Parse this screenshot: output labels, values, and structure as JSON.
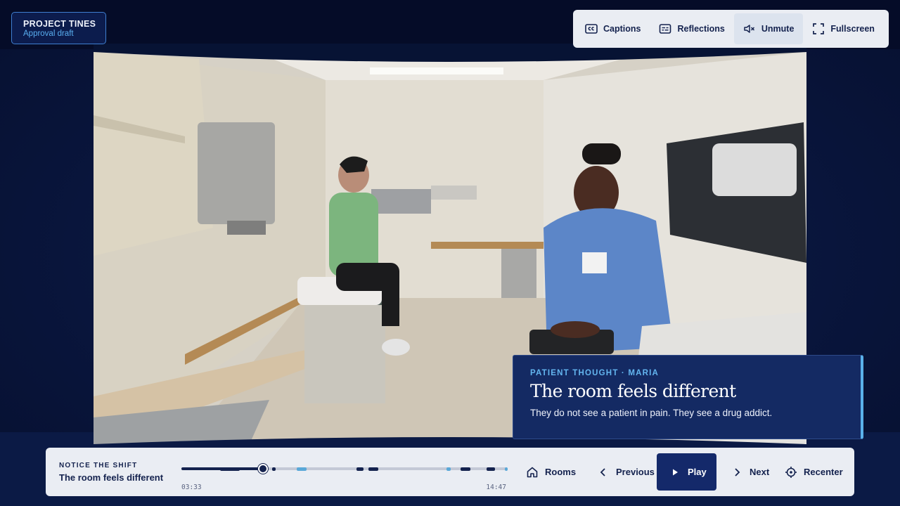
{
  "project": {
    "title": "PROJECT TINES",
    "subtitle": "Approval draft"
  },
  "top_toolbar": {
    "captions": {
      "label": "Captions",
      "icon": "captions-icon"
    },
    "reflections": {
      "label": "Reflections",
      "icon": "reflections-icon"
    },
    "unmute": {
      "label": "Unmute",
      "icon": "muted-speaker-icon",
      "active": true
    },
    "fullscreen": {
      "label": "Fullscreen",
      "icon": "fullscreen-icon"
    }
  },
  "thought": {
    "eyebrow": "PATIENT THOUGHT · MARIA",
    "title": "The room feels different",
    "body": "They do not see a patient in pain. They see a drug addict."
  },
  "player": {
    "eyebrow": "NOTICE THE SHIFT",
    "title": "The room feels different",
    "current_time": "03:33",
    "duration": "14:47",
    "progress": 0.25,
    "rooms_label": "Rooms",
    "previous_label": "Previous",
    "play_label": "Play",
    "next_label": "Next",
    "recenter_label": "Recenter"
  },
  "timeline_markers": [
    {
      "start": 0.12,
      "end": 0.18,
      "color": "#14224e"
    },
    {
      "start": 0.28,
      "end": 0.29,
      "color": "#14224e"
    },
    {
      "start": 0.355,
      "end": 0.385,
      "color": "#5aa8d8"
    },
    {
      "start": 0.54,
      "end": 0.56,
      "color": "#14224e"
    },
    {
      "start": 0.575,
      "end": 0.605,
      "color": "#14224e"
    },
    {
      "start": 0.815,
      "end": 0.83,
      "color": "#5aa8d8"
    },
    {
      "start": 0.86,
      "end": 0.89,
      "color": "#14224e"
    },
    {
      "start": 0.94,
      "end": 0.965,
      "color": "#14224e"
    },
    {
      "start": 0.995,
      "end": 1.0,
      "color": "#5aa8d8"
    }
  ],
  "colors": {
    "accent": "#5ab1ea",
    "navy": "#14224e",
    "play_button": "#14296a"
  }
}
